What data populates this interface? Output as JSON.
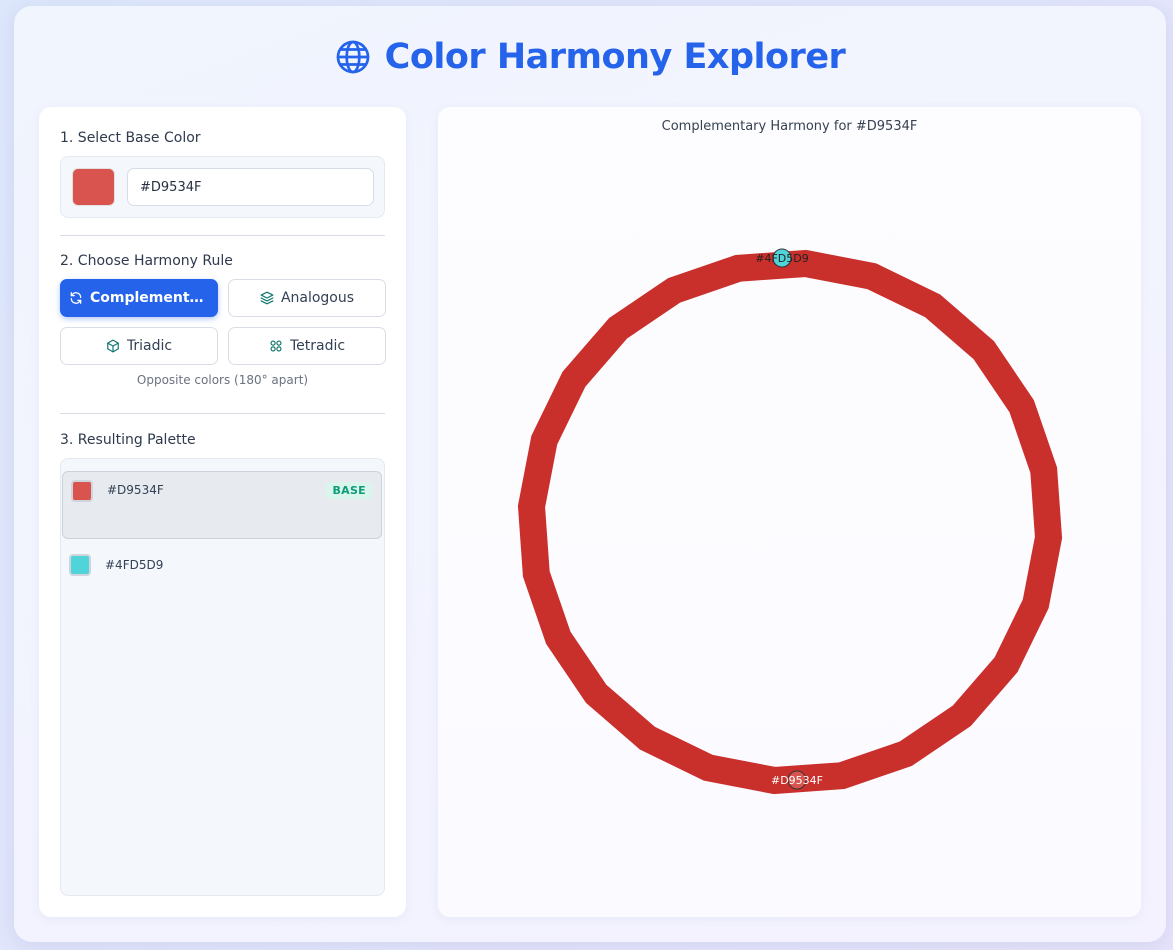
{
  "app": {
    "title": "Color Harmony Explorer",
    "icon": "globe-icon",
    "accent": "#2563eb"
  },
  "base": {
    "section_title": "1. Select Base Color",
    "hex_value": "#D9534F",
    "color": "#D9534F"
  },
  "harmony": {
    "section_title": "2. Choose Harmony Rule",
    "rules": [
      {
        "label": "Complementary",
        "icon": "refresh-icon",
        "active": true
      },
      {
        "label": "Analogous",
        "icon": "layers-icon",
        "active": false
      },
      {
        "label": "Triadic",
        "icon": "cube-icon",
        "active": false
      },
      {
        "label": "Tetradic",
        "icon": "grid-icon",
        "active": false
      }
    ],
    "description": "Opposite colors (180° apart)"
  },
  "palette": {
    "section_title": "3. Resulting Palette",
    "base_badge": "BASE",
    "items": [
      {
        "hex": "#D9534F",
        "color": "#D9534F",
        "is_base": true
      },
      {
        "hex": "#4FD5D9",
        "color": "#4FD5D9",
        "is_base": false
      }
    ]
  },
  "wheel": {
    "title": "Complementary Harmony for #D9534F",
    "ring_color": "#C9302C",
    "markers": [
      {
        "label": "#4FD5D9",
        "color": "#4FD5D9"
      },
      {
        "label": "#D9534F",
        "color": "#D9534F"
      }
    ]
  }
}
